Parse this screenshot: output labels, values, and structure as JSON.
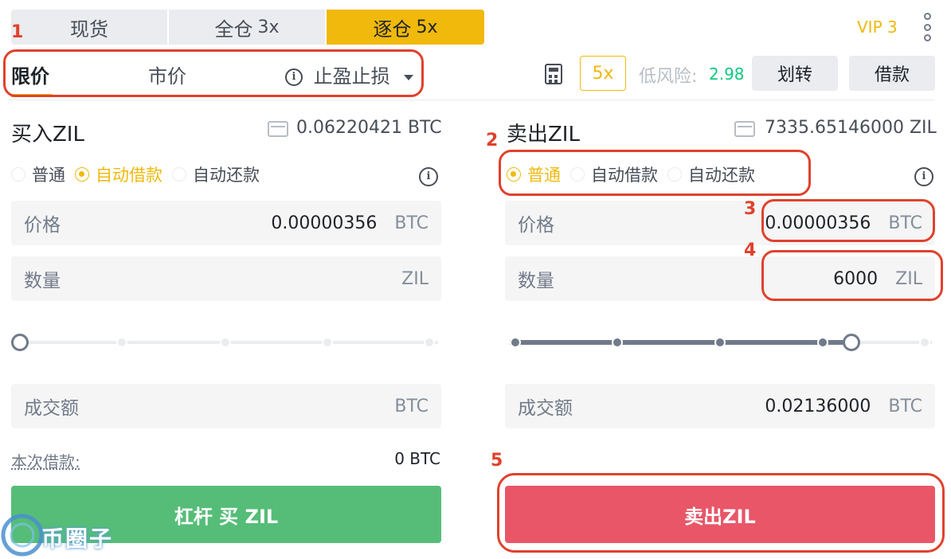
{
  "modes": [
    {
      "label": "现货",
      "leverage": ""
    },
    {
      "label": "全仓",
      "leverage": "3x"
    },
    {
      "label": "逐仓",
      "leverage": "5x"
    }
  ],
  "vip": "VIP 3",
  "order_types": {
    "limit": "限价",
    "market": "市价",
    "stop": "止盈止损"
  },
  "leverage_box": "5x",
  "risk": {
    "label": "低风险:",
    "value": "2.98"
  },
  "buttons": {
    "transfer": "划转",
    "borrow": "借款"
  },
  "buy": {
    "title": "买入ZIL",
    "balance": "0.06220421 BTC",
    "radios": [
      "普通",
      "自动借款",
      "自动还款"
    ],
    "selected_radio": 1,
    "price_label": "价格",
    "price_value": "0.00000356",
    "price_unit": "BTC",
    "qty_label": "数量",
    "qty_value": "",
    "qty_unit": "ZIL",
    "slider_fraction": 0,
    "total_label": "成交额",
    "total_value": "",
    "total_unit": "BTC",
    "borrow_label": "本次借款:",
    "borrow_value": "0 BTC",
    "submit": "杠杆 买 ZIL"
  },
  "sell": {
    "title": "卖出ZIL",
    "balance": "7335.65146000 ZIL",
    "radios": [
      "普通",
      "自动借款",
      "自动还款"
    ],
    "selected_radio": 0,
    "price_label": "价格",
    "price_value": "0.00000356",
    "price_unit": "BTC",
    "qty_label": "数量",
    "qty_value": "6000",
    "qty_unit": "ZIL",
    "slider_fraction": 0.82,
    "total_label": "成交额",
    "total_value": "0.02136000",
    "total_unit": "BTC",
    "submit": "卖出ZIL"
  },
  "annotations": [
    "1",
    "2",
    "3",
    "4",
    "5"
  ],
  "watermark": "币圈子",
  "colors": {
    "accent": "#f0b90b",
    "buy": "#55bd77",
    "sell": "#e85668",
    "risk_ok": "#0ecb81",
    "annotation": "#e0412d"
  }
}
